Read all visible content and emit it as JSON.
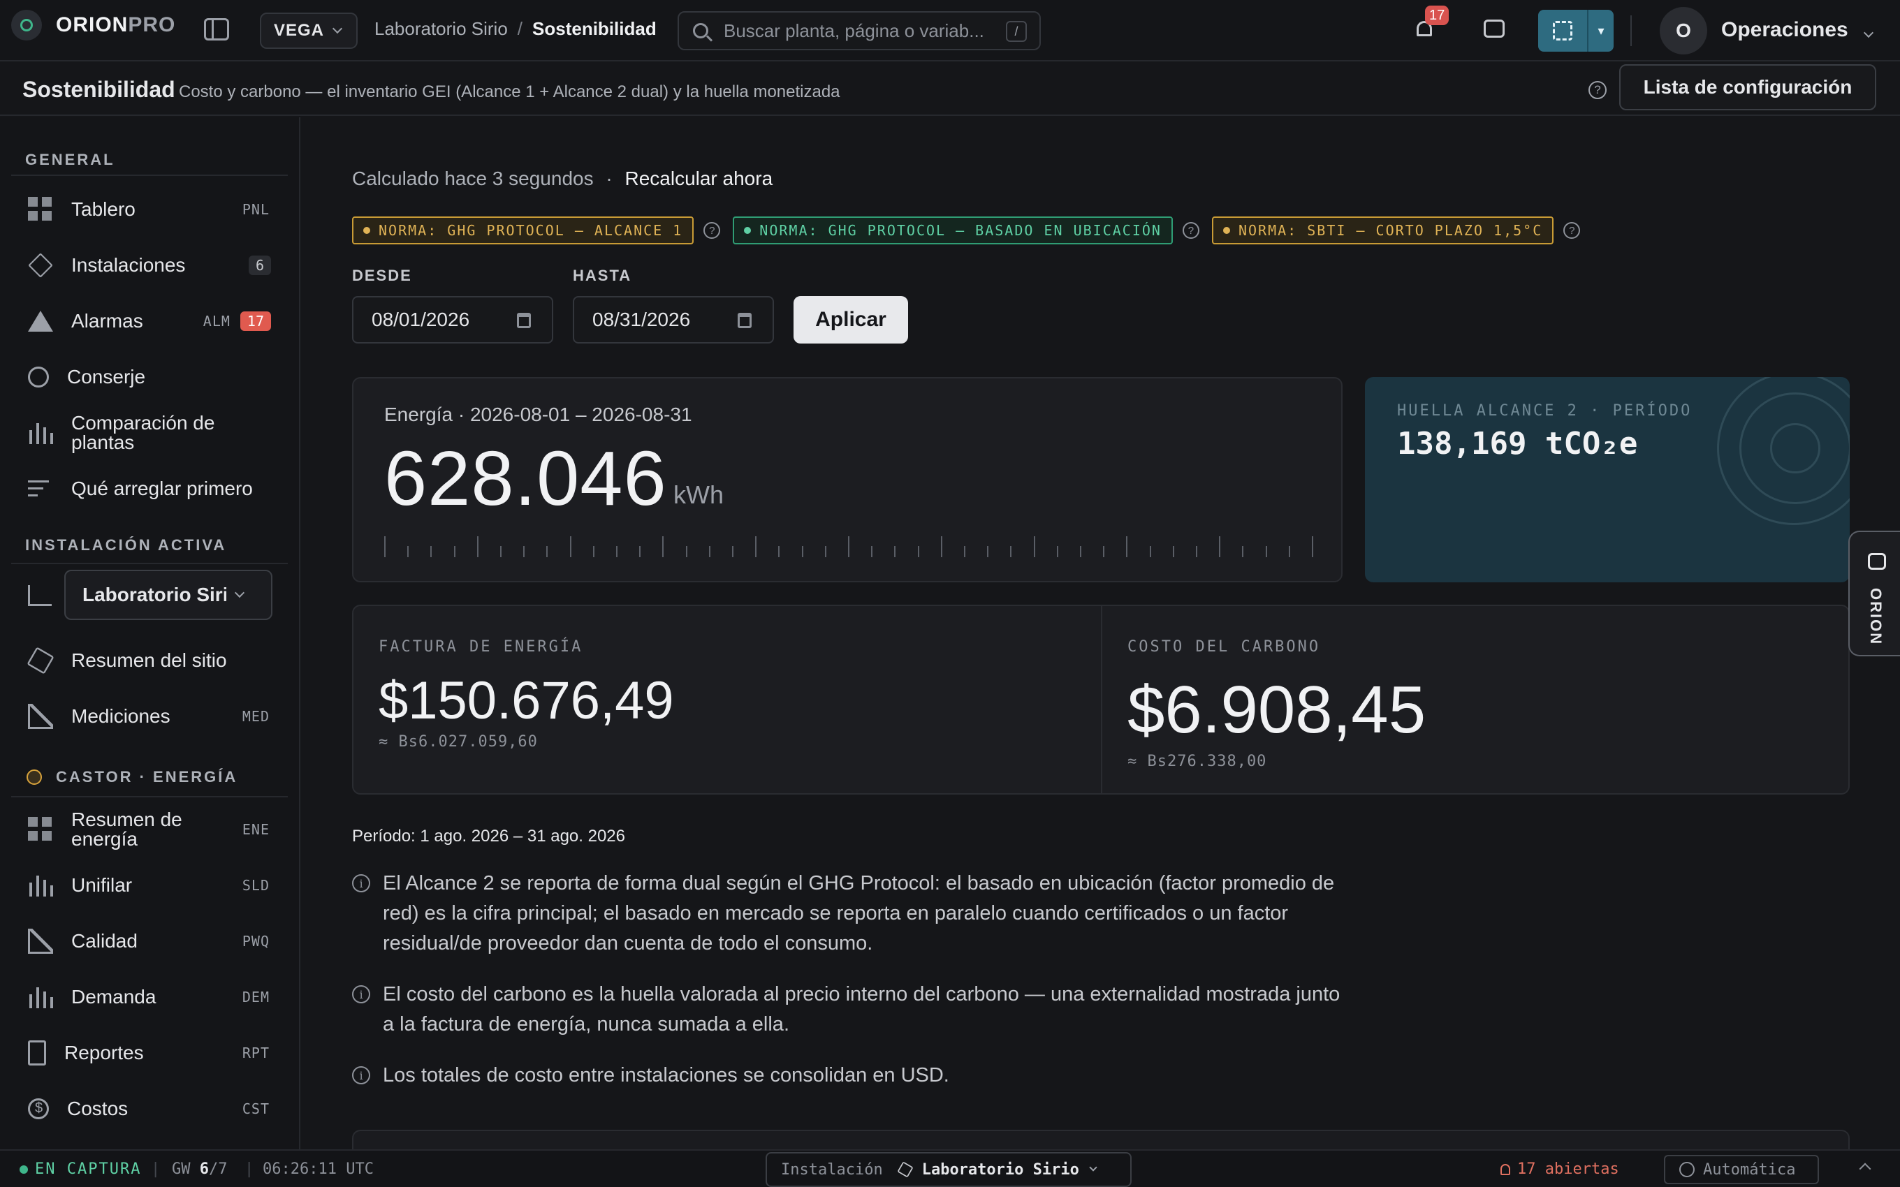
{
  "app": {
    "brand_strong": "ORION",
    "brand_light": "PRO",
    "site_selector": "VEGA",
    "breadcrumb": [
      "Laboratorio Sirio",
      "Sostenibilidad"
    ],
    "search_placeholder": "Buscar planta, página o variab...",
    "search_shortcut": "/",
    "notifications_count": "17",
    "user_initial": "O",
    "user_name": "Operaciones",
    "expand_menu": "▾"
  },
  "page": {
    "title": "Sostenibilidad",
    "subtitle": "Costo y carbono — el inventario GEI (Alcance 1 + Alcance 2 dual) y la huella monetizada",
    "help": "?",
    "config_button": "Lista de configuración"
  },
  "sidebar": {
    "general_title": "GENERAL",
    "general": [
      {
        "label": "Tablero",
        "code": "PNL",
        "icon": "grid-icon"
      },
      {
        "label": "Instalaciones",
        "count": "6",
        "icon": "layers-icon"
      },
      {
        "label": "Alarmas",
        "code": "ALM",
        "badge": "17",
        "icon": "warning-icon"
      },
      {
        "label": "Conserje",
        "icon": "clock-icon"
      },
      {
        "label": "Comparación de plantas",
        "icon": "bar-chart-icon"
      },
      {
        "label": "Qué arreglar primero",
        "icon": "sort-icon"
      }
    ],
    "active_title": "INSTALACIÓN ACTIVA",
    "active_site": "Laboratorio Sirio",
    "site_items": [
      {
        "label": "Resumen del sitio",
        "icon": "box-icon"
      },
      {
        "label": "Mediciones",
        "code": "MED",
        "icon": "line-chart-icon"
      }
    ],
    "castor_title": "CASTOR · ENERGÍA",
    "castor_items": [
      {
        "label": "Resumen de energía",
        "code": "ENE",
        "icon": "grid-icon"
      },
      {
        "label": "Unifilar",
        "code": "SLD",
        "icon": "factory-icon"
      },
      {
        "label": "Calidad",
        "code": "PWQ",
        "icon": "trend-icon"
      },
      {
        "label": "Demanda",
        "code": "DEM",
        "icon": "bar-chart-icon"
      },
      {
        "label": "Reportes",
        "code": "RPT",
        "icon": "document-icon"
      },
      {
        "label": "Costos",
        "code": "CST",
        "icon": "coin-icon"
      }
    ]
  },
  "main": {
    "calc_label": "Calculado",
    "calc_time": "hace 3 segundos",
    "calc_sep": "·",
    "recalc": "Recalcular ahora",
    "tags": [
      {
        "text": "NORMA: GHG PROTOCOL — ALCANCE 1",
        "color": "#e0b356"
      },
      {
        "text": "NORMA: GHG PROTOCOL — BASADO EN UBICACIÓN",
        "color": "#5fd1a5"
      },
      {
        "text": "NORMA: SBTI — CORTO PLAZO 1,5°C",
        "color": "#e0b356"
      }
    ],
    "from_label": "DESDE",
    "from_value": "08/01/2026",
    "to_label": "HASTA",
    "to_value": "08/31/2026",
    "apply": "Aplicar",
    "energy": {
      "header": "Energía · 2026-08-01 – 2026-08-31",
      "value": "628.046",
      "unit": "kWh"
    },
    "scope2": {
      "header": "HUELLA ALCANCE 2 · PERÍODO",
      "value": "138,169 tCO₂e"
    },
    "bill": {
      "header": "FACTURA DE ENERGÍA",
      "value": "$150.676,49",
      "secondary": "≈ Bs6.027.059,60"
    },
    "carbon": {
      "header": "COSTO DEL CARBONO",
      "value": "$6.908,45",
      "secondary": "≈ Bs276.338,00"
    },
    "period": "Período: 1 ago. 2026 – 31 ago. 2026",
    "notes": [
      "El Alcance 2 se reporta de forma dual según el GHG Protocol: el basado en ubicación (factor promedio de red) es la cifra principal; el basado en mercado se reporta en paralelo cuando certificados o un factor residual/de proveedor dan cuenta de todo el consumo.",
      "El costo del carbono es la huella valorada al precio interno del carbono — una externalidad mostrada junto a la factura de energía, nunca sumada a ella.",
      "Los totales de costo entre instalaciones se consolidan en USD."
    ],
    "info_glyph": "i"
  },
  "assistant_tab": "ORION",
  "status": {
    "live": "EN CAPTURA",
    "sep": "|",
    "gw_label": "GW",
    "gw_on": "6",
    "gw_total": "/7",
    "clock": "06:26:11 UTC",
    "inst_label": "Instalación",
    "inst_name": "Laboratorio Sirio",
    "alerts": "17 abiertas",
    "mode": "Automática"
  }
}
